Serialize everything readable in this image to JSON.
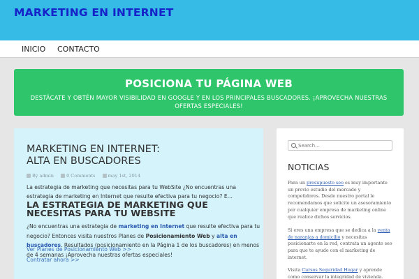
{
  "header": {
    "site_title": "MARKETING EN INTERNET"
  },
  "nav": {
    "items": [
      {
        "label": "INICIO"
      },
      {
        "label": "CONTACTO"
      }
    ]
  },
  "banner": {
    "title": "POSICIONA TU PÁGINA WEB",
    "subtitle": "DESTÁCATE Y OBTÉN MAYOR VISIBILIDAD EN GOOGLE Y EN LOS PRINCIPALES BUSCADORES. ¡APROVECHA NUESTRAS OFERTAS ESPECIALES!"
  },
  "post": {
    "title_line1": "MARKETING EN INTERNET:",
    "title_line2": "ALTA EN BUSCADORES",
    "meta": {
      "author": "By admin",
      "comments": "0 Comments",
      "date": "may 1st, 2014"
    },
    "excerpt": "La estrategia de marketing que necesitas para tu WebSite ¿No encuentras una estrategia de marketing en Internet que resulte efectiva para tu negocio? E...",
    "heading": "LA ESTRATEGIA DE MARKETING QUE NECESITAS PARA TU WEBSITE",
    "body": {
      "p1": "¿No encuentras una estrategia de ",
      "link1": "marketing en Internet",
      "p2": " que resulte efectiva para tu negocio? Entonces visita nuestros Planes de ",
      "bold1": "Posicionamiento Web",
      "p3": " y ",
      "link2": "alta en buscadores",
      "p4": ". Resultados (posicionamiento en la Página 1 de los buscadores) en menos de 4 semanas ¡Aprovecha nuestras ofertas especiales!"
    },
    "more_link1": "Ver Planes de Posicionamiento Web >>",
    "more_link2": "Contratar ahora >>"
  },
  "sidebar": {
    "search_placeholder": "Search...",
    "widget_title": "NOTICIAS",
    "p1_a": "Para un ",
    "p1_link": "presupuesto seo",
    "p1_b": " es muy importante un previo estudio del mercado y competidores. Desde nuestro portal le recomendamos que solicite un asesoramiento por cualquier empresa de marketing online que realice dichos servicios.",
    "p2_a": "Si eres una empresa que se dedica a la ",
    "p2_link": "venta de naranjas a domicilio",
    "p2_b": " y necesitas posicionarte en la red, contrata un agente seo para que te ayude con el marketing de internet.",
    "p3_a": "Visita ",
    "p3_link": "Cursos Seguridad Hogar",
    "p3_b": " y aprende como conservar la integridad de vivienda."
  },
  "colors": {
    "header_bg": "#36bbe6",
    "site_title": "#1523c9",
    "banner_bg": "#2ec56b",
    "post_bg": "#d4f3fb",
    "link": "#2a5ab0"
  }
}
